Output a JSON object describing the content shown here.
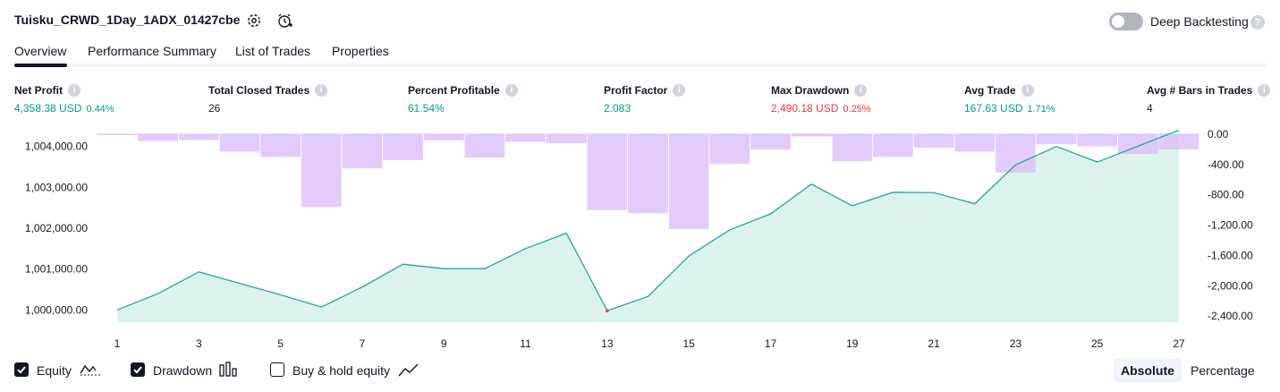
{
  "header": {
    "strategy_name": "Tuisku_CRWD_1Day_1ADX_01427cbe",
    "settings_icon": "gear-icon",
    "alert_icon": "add-alert-icon",
    "deep_backtesting_label": "Deep Backtesting",
    "deep_backtesting_enabled": false,
    "help_glyph": "?"
  },
  "tabs": [
    {
      "label": "Overview",
      "active": true
    },
    {
      "label": "Performance Summary",
      "active": false
    },
    {
      "label": "List of Trades",
      "active": false
    },
    {
      "label": "Properties",
      "active": false
    }
  ],
  "metrics": [
    {
      "label": "Net Profit",
      "value": "4,358.38 USD",
      "pct": "0.44%",
      "color": "#089981"
    },
    {
      "label": "Total Closed Trades",
      "value": "26",
      "pct": "",
      "color": "#131722"
    },
    {
      "label": "Percent Profitable",
      "value": "61.54%",
      "pct": "",
      "color": "#089981"
    },
    {
      "label": "Profit Factor",
      "value": "2.083",
      "pct": "",
      "color": "#089981"
    },
    {
      "label": "Max Drawdown",
      "value": "2,490.18 USD",
      "pct": "0.25%",
      "color": "#f23645"
    },
    {
      "label": "Avg Trade",
      "value": "167.63 USD",
      "pct": "1.71%",
      "color": "#089981"
    },
    {
      "label": "Avg # Bars in Trades",
      "value": "4",
      "pct": "",
      "color": "#131722"
    }
  ],
  "info_glyph": "i",
  "chart_data": {
    "type": "line",
    "x": [
      1,
      2,
      3,
      4,
      5,
      6,
      7,
      8,
      9,
      10,
      11,
      12,
      13,
      14,
      15,
      16,
      17,
      18,
      19,
      20,
      21,
      22,
      23,
      24,
      25,
      26,
      27
    ],
    "xticks": [
      "1",
      "3",
      "5",
      "7",
      "9",
      "11",
      "13",
      "15",
      "17",
      "19",
      "21",
      "23",
      "25",
      "27"
    ],
    "series": [
      {
        "name": "Equity",
        "axis": "left",
        "values": [
          1000000,
          1000400,
          1000930,
          1000650,
          1000370,
          1000070,
          1000560,
          1001120,
          1001010,
          1001010,
          1001500,
          1001880,
          999980,
          1000330,
          1001320,
          1001960,
          1002350,
          1003080,
          1002550,
          1002880,
          1002870,
          1002600,
          1003550,
          1004000,
          1003620,
          1004010,
          1004400
        ]
      },
      {
        "name": "Drawdown",
        "axis": "right",
        "type": "bar",
        "values": [
          -10,
          -90,
          -75,
          -230,
          -300,
          -960,
          -450,
          -340,
          -80,
          -310,
          -100,
          -120,
          -1000,
          -1040,
          -1250,
          -390,
          -200,
          -30,
          -355,
          -300,
          -175,
          -230,
          -505,
          -130,
          -160,
          -260,
          -200
        ]
      }
    ],
    "y_left": {
      "ticks": [
        "1,000,000.00",
        "1,001,000.00",
        "1,002,000.00",
        "1,003,000.00",
        "1,004,000.00"
      ],
      "range": [
        999700,
        1004300
      ]
    },
    "y_right": {
      "ticks": [
        "0.00",
        "-400.00",
        "-800.00",
        "-1,200.00",
        "-1,600.00",
        "-2,000.00",
        "-2,400.00"
      ],
      "range": [
        -2480,
        0
      ]
    },
    "colors": {
      "equity_line": "#26a69a",
      "equity_fill": "#d6f1ea",
      "equity_negative": "#f23645",
      "drawdown_bar": "#dbbdfb",
      "overlap_bar": "#b4b3ed"
    }
  },
  "legend": [
    {
      "label": "Equity",
      "checked": true,
      "icon": "equity-line-icon"
    },
    {
      "label": "Drawdown",
      "checked": true,
      "icon": "drawdown-bars-icon"
    },
    {
      "label": "Buy & hold equity",
      "checked": false,
      "icon": "buy-hold-line-icon"
    }
  ],
  "view_mode": {
    "absolute_label": "Absolute",
    "percentage_label": "Percentage",
    "selected": "Absolute"
  }
}
